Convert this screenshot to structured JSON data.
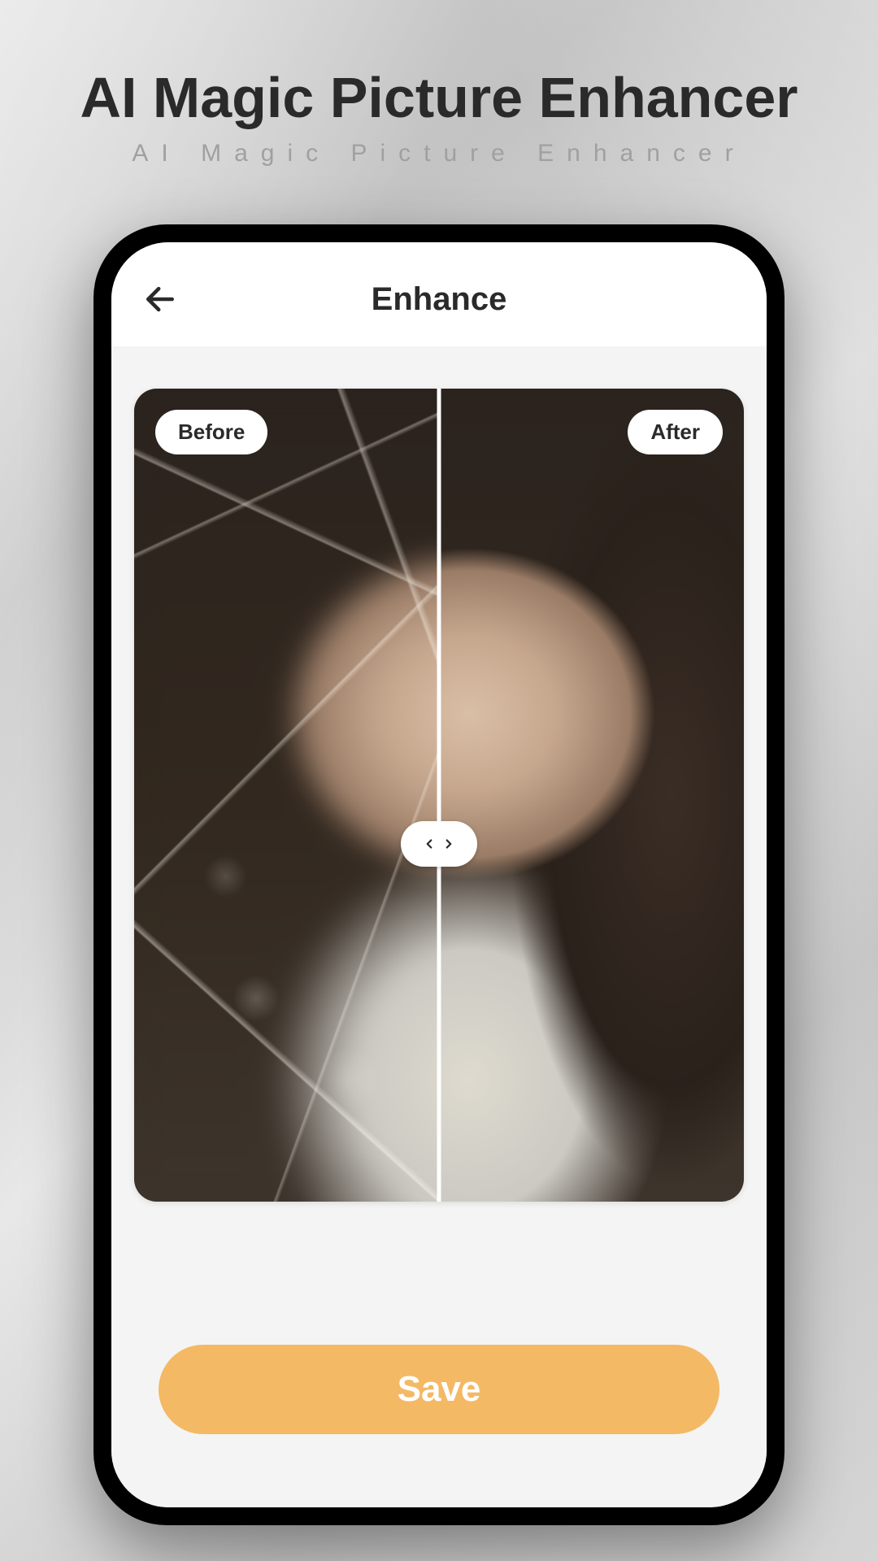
{
  "marketing": {
    "title": "AI Magic Picture Enhancer",
    "subtitle": "AI Magic Picture Enhancer"
  },
  "app": {
    "header_title": "Enhance",
    "compare": {
      "before_label": "Before",
      "after_label": "After"
    },
    "save_label": "Save"
  },
  "colors": {
    "accent": "#f4b964",
    "text_primary": "#2a2a2a",
    "screen_bg": "#f4f4f4"
  },
  "icons": {
    "back": "back-arrow-icon",
    "slider_left": "chevron-left-icon",
    "slider_right": "chevron-right-icon"
  }
}
